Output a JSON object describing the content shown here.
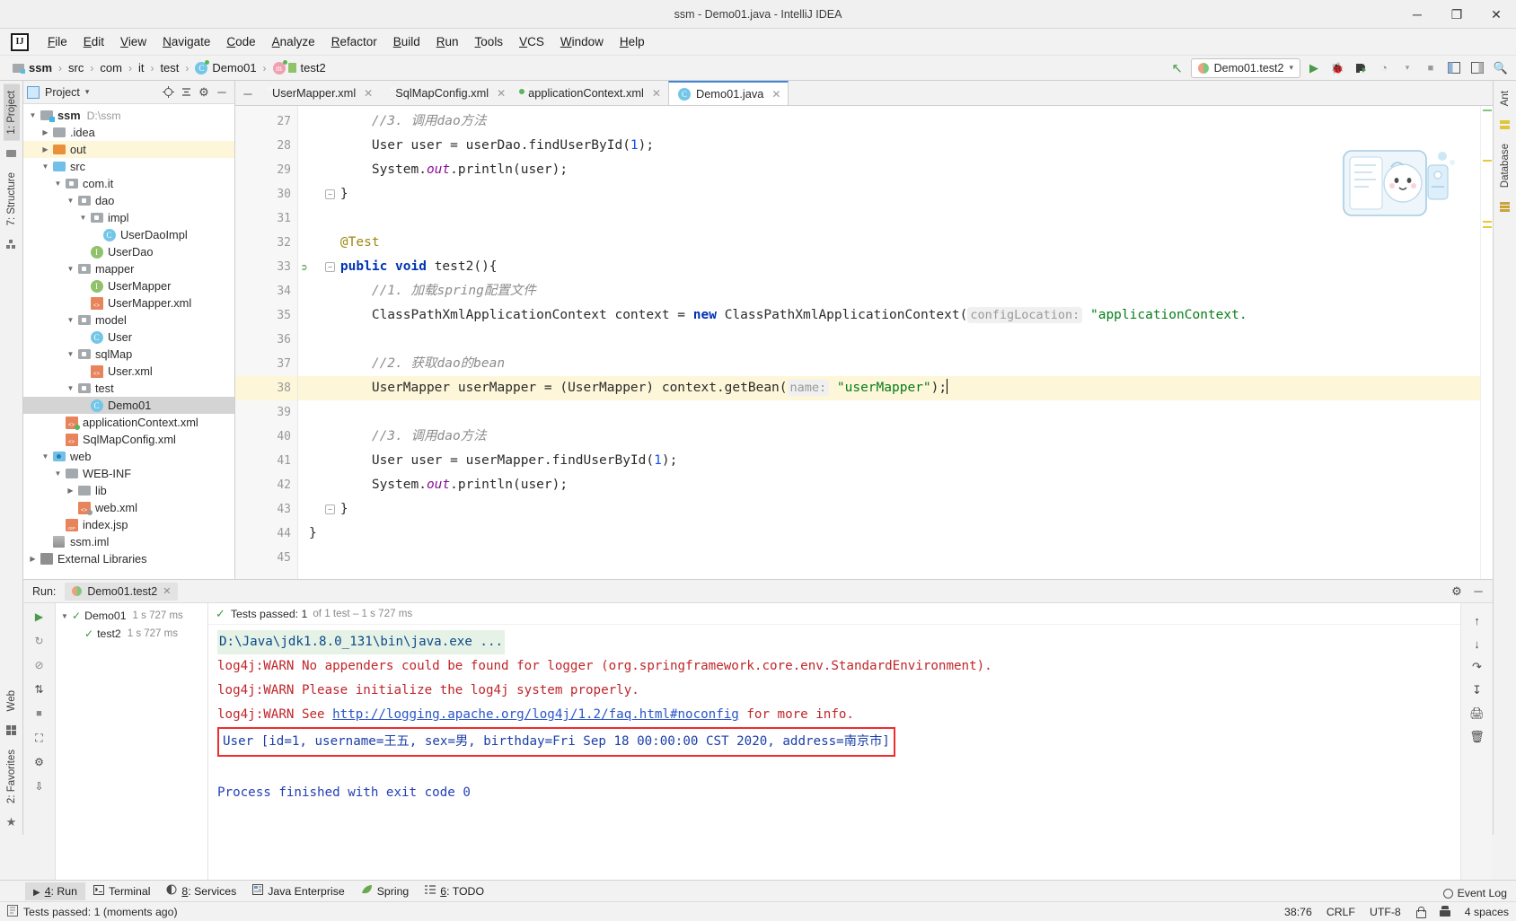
{
  "window": {
    "title": "ssm - Demo01.java - IntelliJ IDEA",
    "logo": "IJ",
    "minimize": "─",
    "maximize": "❐",
    "close": "✕"
  },
  "menubar": {
    "items": [
      {
        "label": "File"
      },
      {
        "label": "Edit"
      },
      {
        "label": "View"
      },
      {
        "label": "Navigate"
      },
      {
        "label": "Code"
      },
      {
        "label": "Analyze"
      },
      {
        "label": "Refactor"
      },
      {
        "label": "Build"
      },
      {
        "label": "Run"
      },
      {
        "label": "Tools"
      },
      {
        "label": "VCS"
      },
      {
        "label": "Window"
      },
      {
        "label": "Help"
      }
    ]
  },
  "breadcrumb": {
    "separator": "›",
    "items": [
      {
        "label": "ssm",
        "icon": "module-icon"
      },
      {
        "label": "src",
        "icon": "folder-icon"
      },
      {
        "label": "com",
        "icon": "package-icon"
      },
      {
        "label": "it",
        "icon": "package-icon"
      },
      {
        "label": "test",
        "icon": "package-icon"
      },
      {
        "label": "Demo01",
        "icon": "class-icon"
      },
      {
        "label": "test2",
        "icon": "method-icon"
      }
    ]
  },
  "toolbar": {
    "build_label": "↖",
    "run_config": "Demo01.test2",
    "dropdown_arrow": "▾",
    "run": "▶",
    "debug": "🐞",
    "run_coverage": "▶",
    "profile": "◔",
    "stop": "■",
    "search": "🔍",
    "settings": "⚙"
  },
  "left_strip": {
    "tabs": [
      {
        "label": "1: Project",
        "active": true
      },
      {
        "label": "7: Structure",
        "active": false
      }
    ],
    "bottom_tabs": [
      {
        "label": "Web"
      },
      {
        "label": "2: Favorites"
      }
    ]
  },
  "right_strip": {
    "tabs": [
      {
        "label": "Ant"
      },
      {
        "label": "Database"
      }
    ]
  },
  "project_panel": {
    "title": "Project",
    "dropdown": "▾",
    "icons": [
      "target-icon",
      "collapse-all-icon",
      "gear-icon",
      "hide-icon"
    ],
    "tree": [
      {
        "depth": 0,
        "arrow": "▼",
        "icon": "module-icon",
        "name": "ssm",
        "bold": true,
        "path": "D:\\ssm",
        "state": "normal"
      },
      {
        "depth": 1,
        "arrow": "▶",
        "icon": "folder-grey-icon",
        "name": ".idea",
        "state": "normal"
      },
      {
        "depth": 1,
        "arrow": "▶",
        "icon": "folder-orange-icon",
        "name": "out",
        "state": "highlight"
      },
      {
        "depth": 1,
        "arrow": "▼",
        "icon": "folder-blue-icon",
        "name": "src",
        "state": "normal"
      },
      {
        "depth": 2,
        "arrow": "▼",
        "icon": "package-icon",
        "name": "com.it",
        "state": "normal"
      },
      {
        "depth": 3,
        "arrow": "▼",
        "icon": "package-icon",
        "name": "dao",
        "state": "normal"
      },
      {
        "depth": 4,
        "arrow": "▼",
        "icon": "package-icon",
        "name": "impl",
        "state": "normal"
      },
      {
        "depth": 5,
        "arrow": "",
        "icon": "class-icon",
        "name": "UserDaoImpl",
        "state": "normal"
      },
      {
        "depth": 4,
        "arrow": "",
        "icon": "interface-icon",
        "name": "UserDao",
        "state": "normal"
      },
      {
        "depth": 3,
        "arrow": "▼",
        "icon": "package-icon",
        "name": "mapper",
        "state": "normal"
      },
      {
        "depth": 4,
        "arrow": "",
        "icon": "interface-icon",
        "name": "UserMapper",
        "state": "normal"
      },
      {
        "depth": 4,
        "arrow": "",
        "icon": "xml-icon",
        "name": "UserMapper.xml",
        "state": "normal"
      },
      {
        "depth": 3,
        "arrow": "▼",
        "icon": "package-icon",
        "name": "model",
        "state": "normal"
      },
      {
        "depth": 4,
        "arrow": "",
        "icon": "class-icon",
        "name": "User",
        "state": "normal"
      },
      {
        "depth": 3,
        "arrow": "▼",
        "icon": "package-icon",
        "name": "sqlMap",
        "state": "normal"
      },
      {
        "depth": 4,
        "arrow": "",
        "icon": "xml-icon",
        "name": "User.xml",
        "state": "normal"
      },
      {
        "depth": 3,
        "arrow": "▼",
        "icon": "package-icon",
        "name": "test",
        "state": "normal"
      },
      {
        "depth": 4,
        "arrow": "",
        "icon": "class-icon",
        "name": "Demo01",
        "state": "selected"
      },
      {
        "depth": 2,
        "arrow": "",
        "icon": "xml-spring-icon",
        "name": "applicationContext.xml",
        "state": "normal"
      },
      {
        "depth": 2,
        "arrow": "",
        "icon": "xml-icon",
        "name": "SqlMapConfig.xml",
        "state": "normal"
      },
      {
        "depth": 1,
        "arrow": "▼",
        "icon": "folder-web-icon",
        "name": "web",
        "state": "normal"
      },
      {
        "depth": 2,
        "arrow": "▼",
        "icon": "folder-grey-icon",
        "name": "WEB-INF",
        "state": "normal"
      },
      {
        "depth": 3,
        "arrow": "▶",
        "icon": "folder-grey-icon",
        "name": "lib",
        "state": "normal"
      },
      {
        "depth": 3,
        "arrow": "",
        "icon": "xml-web-icon",
        "name": "web.xml",
        "state": "normal"
      },
      {
        "depth": 2,
        "arrow": "",
        "icon": "jsp-icon",
        "name": "index.jsp",
        "state": "normal"
      },
      {
        "depth": 1,
        "arrow": "",
        "icon": "iml-icon",
        "name": "ssm.iml",
        "state": "normal"
      },
      {
        "depth": 0,
        "arrow": "▶",
        "icon": "library-icon",
        "name": "External Libraries",
        "state": "normal"
      }
    ]
  },
  "editor": {
    "tabs": [
      {
        "label": "UserMapper.xml",
        "icon": "xml-icon",
        "active": false,
        "close": "✕"
      },
      {
        "label": "SqlMapConfig.xml",
        "icon": "xml-icon",
        "active": false,
        "close": "✕"
      },
      {
        "label": "applicationContext.xml",
        "icon": "xml-spring-icon",
        "active": false,
        "close": "✕"
      },
      {
        "label": "Demo01.java",
        "icon": "class-icon",
        "active": true,
        "close": "✕"
      }
    ],
    "first_line": 27,
    "lines": [
      {
        "n": 27,
        "indent": 8,
        "segs": [
          {
            "t": "//3. 调用dao方法",
            "c": "cmt"
          }
        ]
      },
      {
        "n": 28,
        "indent": 8,
        "segs": [
          {
            "t": "User user = userDao.findUserById(",
            "c": ""
          },
          {
            "t": "1",
            "c": "num"
          },
          {
            "t": ");",
            "c": ""
          }
        ]
      },
      {
        "n": 29,
        "indent": 8,
        "segs": [
          {
            "t": "System.",
            "c": ""
          },
          {
            "t": "out",
            "c": "fld"
          },
          {
            "t": ".println(user);",
            "c": ""
          }
        ]
      },
      {
        "n": 30,
        "indent": 4,
        "segs": [
          {
            "t": "}",
            "c": ""
          }
        ],
        "fold": true
      },
      {
        "n": 31,
        "indent": 0,
        "segs": []
      },
      {
        "n": 32,
        "indent": 4,
        "segs": [
          {
            "t": "@Test",
            "c": "ann"
          }
        ]
      },
      {
        "n": 33,
        "indent": 4,
        "segs": [
          {
            "t": "public",
            "c": "kw"
          },
          {
            "t": " ",
            "c": ""
          },
          {
            "t": "void",
            "c": "kw"
          },
          {
            "t": " test2(){",
            "c": ""
          }
        ],
        "runmark": true,
        "fold": true
      },
      {
        "n": 34,
        "indent": 8,
        "segs": [
          {
            "t": "//1. 加载spring配置文件",
            "c": "cmt"
          }
        ]
      },
      {
        "n": 35,
        "indent": 8,
        "segs": [
          {
            "t": "ClassPathXmlApplicationContext context = ",
            "c": ""
          },
          {
            "t": "new",
            "c": "kw"
          },
          {
            "t": " ClassPathXmlApplicationContext(",
            "c": ""
          },
          {
            "t": "configLocation:",
            "c": "hint"
          },
          {
            "t": " \"applicationContext.",
            "c": "str"
          }
        ]
      },
      {
        "n": 36,
        "indent": 0,
        "segs": []
      },
      {
        "n": 37,
        "indent": 8,
        "segs": [
          {
            "t": "//2. 获取dao的bean",
            "c": "cmt"
          }
        ]
      },
      {
        "n": 38,
        "indent": 8,
        "segs": [
          {
            "t": "UserMapper userMapper = (UserMapper) context.getBean(",
            "c": ""
          },
          {
            "t": "name:",
            "c": "hint"
          },
          {
            "t": " ",
            "c": ""
          },
          {
            "t": "\"userMapper\"",
            "c": "str"
          },
          {
            "t": ");",
            "c": ""
          }
        ],
        "highlight": true,
        "caret": true
      },
      {
        "n": 39,
        "indent": 0,
        "segs": []
      },
      {
        "n": 40,
        "indent": 8,
        "segs": [
          {
            "t": "//3. 调用dao方法",
            "c": "cmt"
          }
        ]
      },
      {
        "n": 41,
        "indent": 8,
        "segs": [
          {
            "t": "User user = userMapper.findUserById(",
            "c": ""
          },
          {
            "t": "1",
            "c": "num"
          },
          {
            "t": ");",
            "c": ""
          }
        ]
      },
      {
        "n": 42,
        "indent": 8,
        "segs": [
          {
            "t": "System.",
            "c": ""
          },
          {
            "t": "out",
            "c": "fld"
          },
          {
            "t": ".println(user);",
            "c": ""
          }
        ]
      },
      {
        "n": 43,
        "indent": 4,
        "segs": [
          {
            "t": "}",
            "c": ""
          }
        ],
        "fold": true
      },
      {
        "n": 44,
        "indent": 0,
        "segs": [
          {
            "t": "}",
            "c": ""
          }
        ]
      },
      {
        "n": 45,
        "indent": 0,
        "segs": []
      }
    ]
  },
  "run_panel": {
    "label": "Run:",
    "tab_label": "Demo01.test2",
    "tab_close": "✕",
    "gear": "⚙",
    "minimize": "─",
    "test_status": {
      "check": "✓",
      "text": "Tests passed: 1",
      "detail": "of 1 test – 1 s 727 ms"
    },
    "test_tree": [
      {
        "depth": 0,
        "arrow": "▼",
        "check": "✓",
        "name": "Demo01",
        "time": "1 s 727 ms"
      },
      {
        "depth": 1,
        "arrow": "",
        "check": "✓",
        "name": "test2",
        "time": "1 s 727 ms"
      }
    ],
    "console": [
      {
        "type": "cmd",
        "text": "D:\\Java\\jdk1.8.0_131\\bin\\java.exe ..."
      },
      {
        "type": "warn",
        "text": "log4j:WARN No appenders could be found for logger (org.springframework.core.env.StandardEnvironment)."
      },
      {
        "type": "warn",
        "text": "log4j:WARN Please initialize the log4j system properly."
      },
      {
        "type": "warn-link",
        "pre": "log4j:WARN See ",
        "link": "http://logging.apache.org/log4j/1.2/faq.html#noconfig",
        "post": " for more info."
      },
      {
        "type": "boxed",
        "text": "User [id=1, username=王五, sex=男, birthday=Fri Sep 18 00:00:00 CST 2020, address=南京市]"
      },
      {
        "type": "blank",
        "text": ""
      },
      {
        "type": "exit",
        "text": "Process finished with exit code 0"
      }
    ],
    "side_icons": [
      "rerun-icon",
      "rerun-failed-icon",
      "pause-icon",
      "stop-icon",
      "camera-icon",
      "filter-icon",
      "export-icon"
    ],
    "console_right_icons": [
      "scroll-up-icon",
      "scroll-down-icon",
      "soft-wrap-icon",
      "scroll-end-icon",
      "print-icon",
      "trash-icon"
    ]
  },
  "bottom_toolbar": {
    "items": [
      {
        "label": "4: Run",
        "icon": "run-icon",
        "active": true
      },
      {
        "label": "Terminal",
        "icon": "terminal-icon",
        "active": false
      },
      {
        "label": "8: Services",
        "icon": "services-icon",
        "active": false
      },
      {
        "label": "Java Enterprise",
        "icon": "java-ee-icon",
        "active": false
      },
      {
        "label": "Spring",
        "icon": "spring-leaf-icon",
        "active": false
      },
      {
        "label": "6: TODO",
        "icon": "todo-icon",
        "active": false
      }
    ]
  },
  "statusbar": {
    "message": "Tests passed: 1 (moments ago)",
    "event_log": "Event Log",
    "caret_position": "38:76",
    "line_separator": "CRLF",
    "encoding": "UTF-8",
    "indent": "4 spaces"
  }
}
